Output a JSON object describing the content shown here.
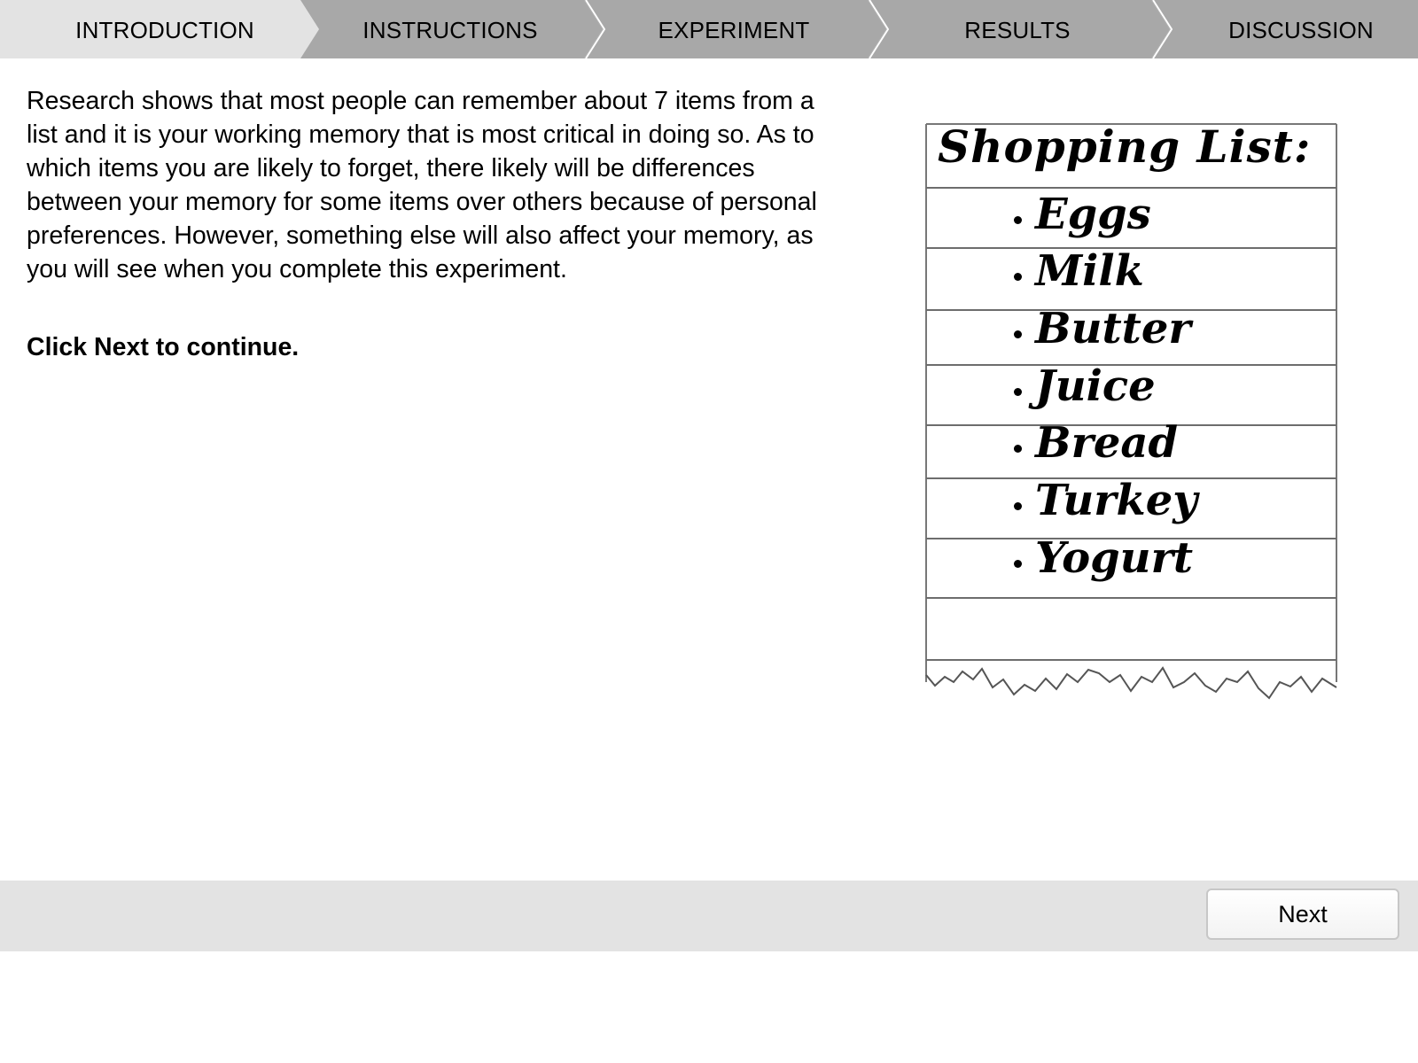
{
  "steps": [
    {
      "label": "INTRODUCTION",
      "active": true
    },
    {
      "label": "INSTRUCTIONS",
      "active": false
    },
    {
      "label": "EXPERIMENT",
      "active": false
    },
    {
      "label": "RESULTS",
      "active": false
    },
    {
      "label": "DISCUSSION",
      "active": false
    }
  ],
  "colors": {
    "active_tab": "#e3e3e3",
    "inactive_tab": "#a8a8a8",
    "footer": "#e3e3e3"
  },
  "intro": {
    "paragraph": "Research shows that most people can remember about 7 items from a list and it is your working memory that is most critical in doing so. As to which items you are likely to forget, there likely will be differences between your memory for some items over others because of personal preferences. However, something else will also affect your memory, as you will see when you complete this experiment.",
    "cta": "Click Next to continue."
  },
  "shopping_list": {
    "title": "Shopping List:",
    "items": [
      "Eggs",
      "Milk",
      "Butter",
      "Juice",
      "Bread",
      "Turkey",
      "Yogurt"
    ]
  },
  "footer": {
    "next_label": "Next"
  }
}
